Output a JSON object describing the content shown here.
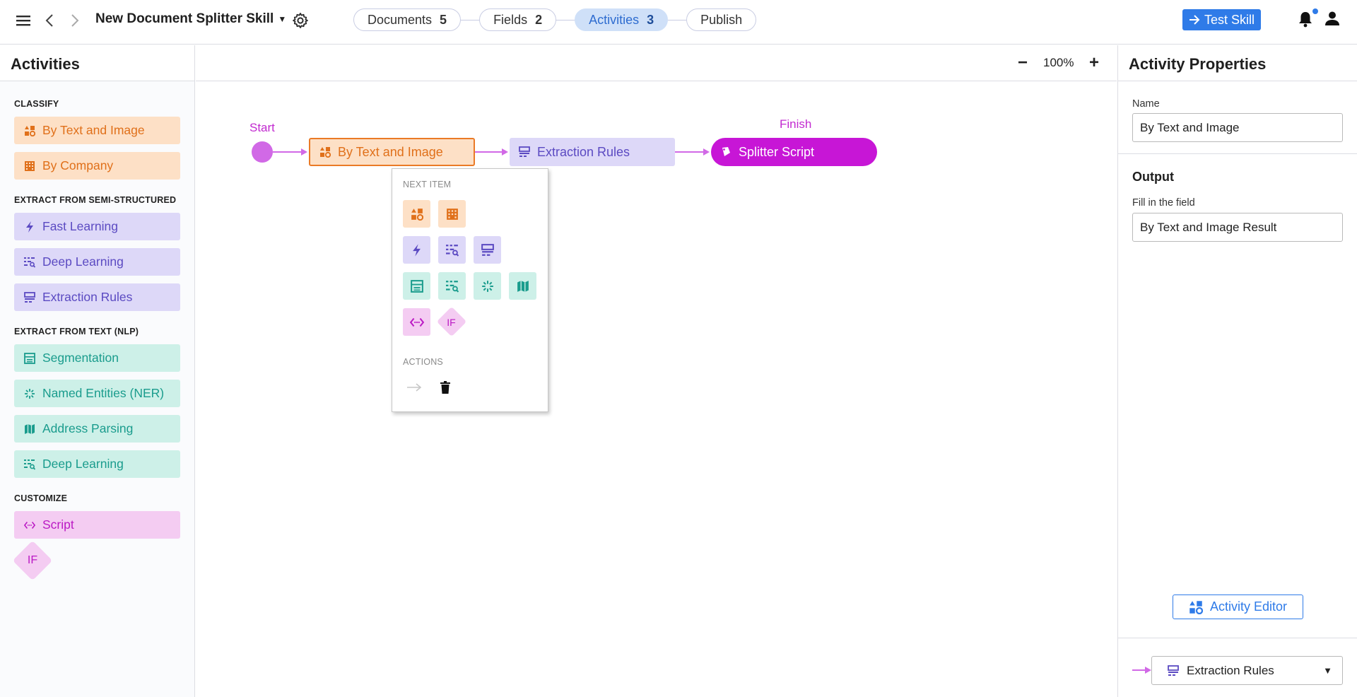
{
  "topbar": {
    "title": "New Document Splitter Skill",
    "steps": [
      {
        "label": "Documents",
        "count": "5"
      },
      {
        "label": "Fields",
        "count": "2"
      },
      {
        "label": "Activities",
        "count": "3"
      },
      {
        "label": "Publish",
        "count": ""
      }
    ],
    "active_step": "Activities",
    "test_label": "Test Skill"
  },
  "left": {
    "title": "Activities",
    "groups": {
      "classify": "CLASSIFY",
      "semi": "EXTRACT FROM SEMI-STRUCTURED",
      "nlp": "EXTRACT FROM TEXT (NLP)",
      "customize": "CUSTOMIZE"
    },
    "items": {
      "by_text_image": "By Text and Image",
      "by_company": "By Company",
      "fast_learning": "Fast Learning",
      "deep_learning_semi": "Deep Learning",
      "extraction_rules": "Extraction Rules",
      "segmentation": "Segmentation",
      "ner": "Named Entities (NER)",
      "address": "Address Parsing",
      "deep_learning_nlp": "Deep Learning",
      "script": "Script",
      "if": "IF"
    }
  },
  "canvas": {
    "zoom": "100%",
    "zoom_out": "−",
    "zoom_in": "+",
    "start_label": "Start",
    "finish_label": "Finish",
    "nodes": {
      "selected": "By Text and Image",
      "extraction": "Extraction Rules",
      "finish": "Splitter Script"
    },
    "popup": {
      "next_item": "NEXT ITEM",
      "actions": "ACTIONS",
      "if_label": "IF"
    }
  },
  "right": {
    "title": "Activity Properties",
    "name_label": "Name",
    "name_value": "By Text and Image",
    "output_heading": "Output",
    "fill_label": "Fill in the field",
    "fill_value": "By Text and Image Result",
    "editor_button": "Activity Editor",
    "next_activity": "Extraction Rules"
  },
  "colors": {
    "accent": "#2f7be8",
    "classify": "#e0701a",
    "semi_structured": "#5b4ac2",
    "nlp": "#1a9c8d",
    "customize": "#bb1ac4"
  }
}
